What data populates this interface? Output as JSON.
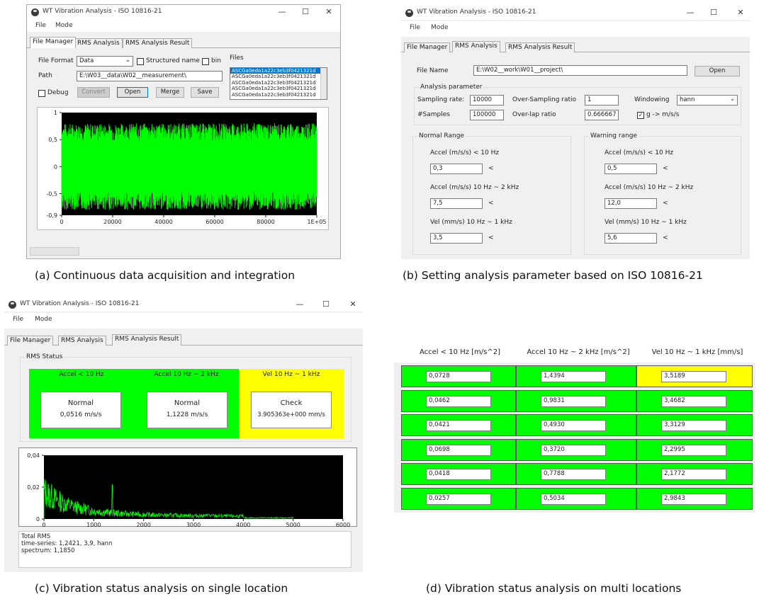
{
  "app": {
    "title": "WT Vibration Analysis - ISO 10816-21",
    "menu": [
      "File",
      "Mode"
    ],
    "tabs": [
      "File Manager",
      "RMS Analysis",
      "RMS Analysis Result"
    ],
    "controls": {
      "minimize": "—",
      "maximize": "☐",
      "close": "✕"
    }
  },
  "panel_a": {
    "caption": "(a) Continuous data acquisition and integration",
    "file_format_label": "File Format",
    "file_format_value": "Data",
    "structured_name_label": "Structured name",
    "bin_label": "bin",
    "files_label": "Files",
    "path_label": "Path",
    "path_value": "E:\\W03__data\\W02__measurement\\",
    "files": [
      "ASCGa0eda1a22c3eb3f0421321d",
      "ASCGa0eda1a22c3eb3f0421321d",
      "ASCGa0eda1a22c3eb3f0421321d",
      "ASCGa0eda1a22c3eb3f0421321d",
      "ASCGa0eda1a22c3eb3f0421321d",
      "ASCGa0eda1a22c3eb3f0421321d"
    ],
    "debug_label": "Debug",
    "convert_label": "Convert",
    "open_label": "Open",
    "merge_label": "Merge",
    "save_label": "Save"
  },
  "panel_b": {
    "caption": "(b) Setting analysis parameter based on ISO 10816-21",
    "file_name_label": "File Name",
    "file_name_value": "E:\\W02__work\\W01__project\\",
    "open_label": "Open",
    "analysis_parameter_label": "Analysis parameter",
    "sampling_rate_label": "Sampling rate:",
    "sampling_rate_value": "10000",
    "oversampling_label": "Over-Sampling ratio",
    "oversampling_value": "1",
    "windowing_label": "Windowing",
    "windowing_value": "hann",
    "samples_label": "#Samples",
    "samples_value": "100000",
    "overlap_label": "Over-lap ratio",
    "overlap_value": "0.666667",
    "g_convert_label": "g -> m/s/s",
    "normal_range": {
      "title": "Normal Range",
      "rows": [
        {
          "label": "Accel (m/s/s)   < 10 Hz",
          "value": "0,3"
        },
        {
          "label": "Accel (m/s/s)   10 Hz ~ 2 kHz",
          "value": "7,5"
        },
        {
          "label": "Vel (mm/s)   10 Hz ~ 1 kHz",
          "value": "3,5"
        }
      ]
    },
    "warning_range": {
      "title": "Warning range",
      "rows": [
        {
          "label": "Accel (m/s/s)   < 10 Hz",
          "value": "0,5"
        },
        {
          "label": "Accel (m/s/s)   10 Hz ~ 2 kHz",
          "value": "12,0"
        },
        {
          "label": "Vel (mm/s)   10 Hz ~ 1 kHz",
          "value": "5,6"
        }
      ]
    },
    "less_than": "<"
  },
  "panel_c": {
    "caption": "(c) Vibration status analysis on single location",
    "rms_status_label": "RMS Status",
    "cells": [
      {
        "header": "Accel < 10 Hz",
        "status": "Normal",
        "value": "0,0516 m/s/s",
        "color": "#00ff00"
      },
      {
        "header": "Accel 10 Hz ~ 2 kHz",
        "status": "Normal",
        "value": "1,1228 m/s/s",
        "color": "#00ff00"
      },
      {
        "header": "Vel 10 Hz ~ 1 kHz",
        "status": "Check",
        "value": "3.905363e+000 mm/s",
        "color": "#ffff00"
      }
    ],
    "total_rms_lines": [
      "Total RMS",
      "time-series: 1,2421, 3,9, hann",
      "spectrum: 1,1850"
    ]
  },
  "panel_d": {
    "caption": "(d) Vibration status analysis on multi locations",
    "headers": [
      "Accel < 10 Hz [m/s^2]",
      "Accel 10 Hz ~ 2 kHz [m/s^2]",
      "Vel 10 Hz ~ 1 kHz [mm/s]"
    ],
    "rows": [
      [
        "0,0728",
        "1,4394",
        "3,5189"
      ],
      [
        "0,0462",
        "0,9831",
        "3,4682"
      ],
      [
        "0,0421",
        "0,4930",
        "3,3129"
      ],
      [
        "0,0698",
        "0,3720",
        "2,2995"
      ],
      [
        "0,0418",
        "0,7788",
        "2,1772"
      ],
      [
        "0,0257",
        "0,5034",
        "2,9843"
      ]
    ],
    "row_colors": [
      [
        "#00ff00",
        "#00ff00",
        "#ffff00"
      ],
      [
        "#00ff00",
        "#00ff00",
        "#00ff00"
      ],
      [
        "#00ff00",
        "#00ff00",
        "#00ff00"
      ],
      [
        "#00ff00",
        "#00ff00",
        "#00ff00"
      ],
      [
        "#00ff00",
        "#00ff00",
        "#00ff00"
      ],
      [
        "#00ff00",
        "#00ff00",
        "#00ff00"
      ]
    ]
  },
  "chart_data": [
    {
      "type": "line",
      "y_ticks": [
        "1",
        "0,5",
        "0",
        "-0,5",
        "-0,9"
      ],
      "x_ticks": [
        "0",
        "20000",
        "40000",
        "60000",
        "80000",
        "1E+05"
      ],
      "xlim": [
        0,
        100000
      ],
      "ylim": [
        -0.9,
        1
      ],
      "series_color": "#00ff00",
      "background": "#000000"
    },
    {
      "type": "line",
      "y_ticks": [
        "0,04",
        "0,02",
        "0"
      ],
      "x_ticks": [
        "0",
        "1000",
        "2000",
        "3000",
        "4000",
        "5000",
        "6000"
      ],
      "xlim": [
        0,
        6000
      ],
      "ylim": [
        0,
        0.04
      ],
      "series_color": "#00ff00",
      "background": "#000000"
    }
  ]
}
